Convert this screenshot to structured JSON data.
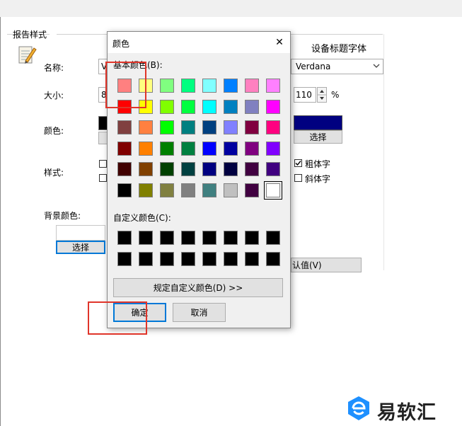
{
  "report_style": {
    "group_title": "报告样式",
    "name_label": "名称:",
    "name_value": "V",
    "size_label": "大小:",
    "size_value": "8",
    "color_label": "颜色:",
    "style_label": "样式:",
    "bg_color_label": "背景颜色:",
    "bg_select_button": "选择"
  },
  "device_font": {
    "title": "设备标题字体",
    "font_value": "Verdana",
    "size_value": "110",
    "size_unit": "%",
    "color_hex": "#000080",
    "select_button": "选择",
    "bold_label": "粗体字",
    "bold_checked": true,
    "italic_label": "斜体字",
    "italic_checked": false,
    "default_button": "认值(V)"
  },
  "color_dialog": {
    "title": "颜色",
    "close_glyph": "✕",
    "basic_colors_label": "基本颜色(B):",
    "custom_colors_label": "自定义颜色(C):",
    "define_custom_button": "规定自定义颜色(D) >>",
    "ok_button": "确定",
    "cancel_button": "取消",
    "basic_colors": [
      [
        "#ff8080",
        "#ffff80",
        "#80ff80",
        "#00ff80",
        "#80ffff",
        "#0080ff",
        "#ff80c0",
        "#ff80ff"
      ],
      [
        "#ff0000",
        "#ffff00",
        "#80ff00",
        "#00ff40",
        "#00ffff",
        "#0080c0",
        "#8080c0",
        "#ff00ff"
      ],
      [
        "#804040",
        "#ff8040",
        "#00ff00",
        "#008080",
        "#004080",
        "#8080ff",
        "#800040",
        "#ff0080"
      ],
      [
        "#800000",
        "#ff8000",
        "#008000",
        "#008040",
        "#0000ff",
        "#0000a0",
        "#800080",
        "#8000ff"
      ],
      [
        "#400000",
        "#804000",
        "#004000",
        "#004040",
        "#000080",
        "#000040",
        "#400040",
        "#400080"
      ],
      [
        "#000000",
        "#808000",
        "#808040",
        "#808080",
        "#408080",
        "#c0c0c0",
        "#400040",
        "#ffffff"
      ]
    ],
    "selected_basic_index": [
      5,
      7
    ],
    "custom_colors": [
      [
        "#000000",
        "#000000",
        "#000000",
        "#000000",
        "#000000",
        "#000000",
        "#000000",
        "#000000"
      ],
      [
        "#000000",
        "#000000",
        "#000000",
        "#000000",
        "#000000",
        "#000000",
        "#000000",
        "#000000"
      ]
    ]
  },
  "watermark": {
    "text": "易软汇",
    "logo_icon": "e-logo-icon",
    "logo_color": "#1e90ff"
  },
  "icons": {
    "report_icon": "notepad-pencil-icon"
  },
  "highlight_color": "#e0352a"
}
